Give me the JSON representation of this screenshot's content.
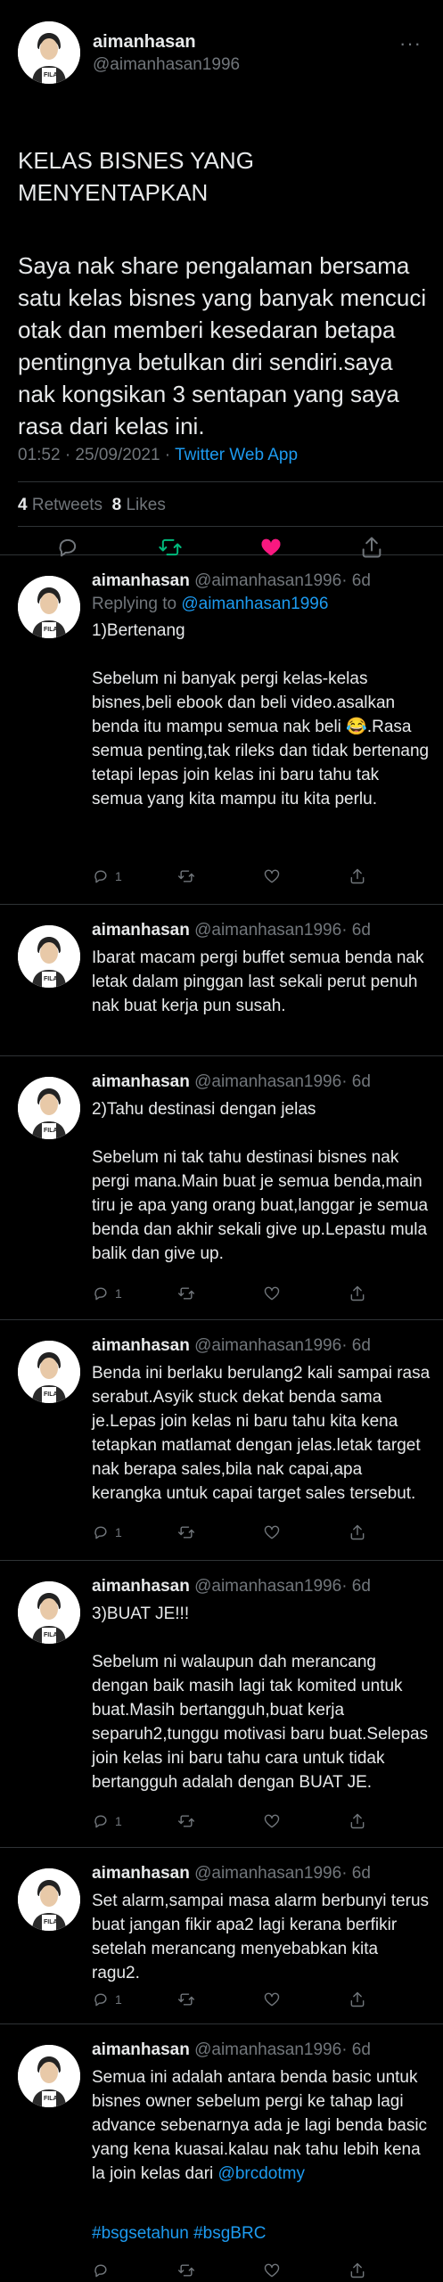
{
  "author": {
    "name": "aimanhasan",
    "handle": "@aimanhasan1996"
  },
  "main_tweet": {
    "title": "KELAS BISNES YANG MENYENTAPKAN",
    "body": "Saya nak share pengalaman bersama satu kelas bisnes yang banyak mencuci otak dan memberi kesedaran betapa pentingnya betulkan diri sendiri.saya nak kongsikan 3 sentapan yang saya rasa dari kelas ini.",
    "time": "01:52 · 25/09/2021 · ",
    "app": "Twitter Web App",
    "retweets_count": "4",
    "retweets_label": "Retweets",
    "likes_count": "8",
    "likes_label": "Likes"
  },
  "replies": [
    {
      "date": "· 6d",
      "replying_label": "Replying to ",
      "replying_to": "@aimanhasan1996",
      "text_before": "1)Bertenang\n\nSebelum ni banyak pergi kelas-kelas bisnes,beli ebook dan beli video.asalkan benda itu mampu semua nak beli ",
      "emoji": "😂",
      "text_after": ".Rasa semua penting,tak rileks dan tidak bertenang tetapi lepas join kelas ini baru tahu tak semua yang kita mampu itu kita perlu.",
      "reply_count": "1"
    },
    {
      "date": "· 6d",
      "text": "Ibarat macam pergi buffet semua benda nak letak dalam pinggan last sekali perut penuh nak buat kerja pun susah."
    },
    {
      "date": "· 6d",
      "text": "2)Tahu destinasi dengan jelas\n\nSebelum ni tak tahu destinasi bisnes nak pergi mana.Main buat je semua benda,main tiru je apa yang orang buat,langgar je semua benda dan akhir sekali give up.Lepastu mula balik dan give up.",
      "reply_count": "1"
    },
    {
      "date": "· 6d",
      "text": "Benda ini berlaku berulang2 kali sampai rasa serabut.Asyik stuck dekat benda sama je.Lepas join kelas ni baru tahu kita kena tetapkan matlamat dengan jelas.letak target nak berapa sales,bila nak capai,apa kerangka untuk capai target sales tersebut.",
      "reply_count": "1"
    },
    {
      "date": "· 6d",
      "text": "3)BUAT JE!!!\n\nSebelum ni walaupun dah merancang dengan baik masih lagi tak komited untuk buat.Masih bertangguh,buat kerja separuh2,tunggu motivasi baru buat.Selepas join kelas ini baru tahu cara untuk tidak bertangguh adalah dengan BUAT JE.",
      "reply_count": "1"
    },
    {
      "date": "· 6d",
      "text": "Set alarm,sampai masa alarm berbunyi terus buat jangan fikir apa2 lagi kerana berfikir setelah merancang menyebabkan kita ragu2.",
      "reply_count": "1"
    },
    {
      "date": "· 6d",
      "text_before": "Semua ini adalah antara benda basic untuk bisnes owner sebelum pergi ke tahap lagi advance sebenarnya ada je lagi benda basic yang kena kuasai.kalau nak tahu lebih kena la join kelas dari ",
      "mention": "@brcdotmy",
      "hashtags": "#bsgsetahun #bsgBRC"
    }
  ],
  "colors": {
    "accent": "#1d9bf0",
    "like": "#f91880",
    "retweet": "#00ba7c",
    "background": "#000000"
  },
  "icons": [
    "verified-avatar",
    "more-icon",
    "reply-icon",
    "retweet-icon",
    "like-icon",
    "share-icon"
  ]
}
